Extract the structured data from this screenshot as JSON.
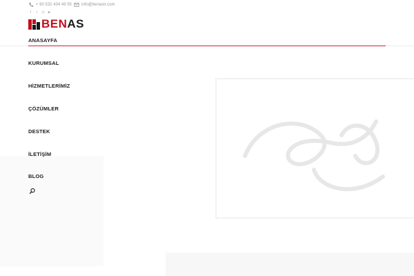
{
  "topbar": {
    "phone": "+ 90 532 434 49 55",
    "email": "info@benastr.com",
    "social": [
      {
        "icon": "facebook-icon",
        "glyph": "f"
      },
      {
        "icon": "twitter-icon",
        "glyph": "t"
      },
      {
        "icon": "instagram-icon",
        "glyph": "◎"
      },
      {
        "icon": "youtube-icon",
        "glyph": "▶"
      }
    ]
  },
  "logo": {
    "part1": "BEN",
    "part2": "AS",
    "colors": {
      "red": "#c0111f",
      "dark": "#1a1a1a"
    }
  },
  "nav": {
    "items": [
      {
        "label": "ANASAYFA",
        "active": true
      },
      {
        "label": "KURUMSAL"
      },
      {
        "label": "HİZMETLERİMİZ"
      },
      {
        "label": "ÇÖZÜMLER"
      },
      {
        "label": "DESTEK"
      },
      {
        "label": "İLETİŞİM"
      },
      {
        "label": "BLOG"
      }
    ],
    "accent": "#c9232e"
  },
  "search": {
    "icon": "search-icon"
  }
}
